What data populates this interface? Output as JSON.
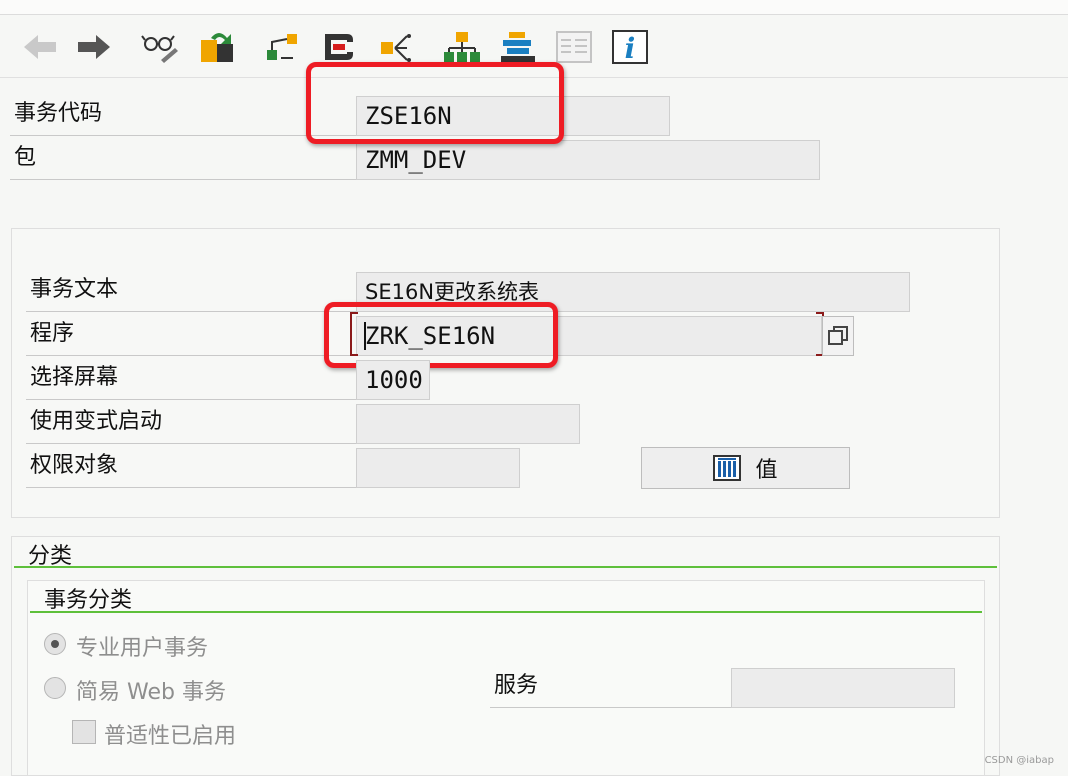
{
  "toolbar": {
    "icons": [
      "back-arrow-icon",
      "forward-arrow-icon",
      "display-glasses-icon",
      "change-object-icon",
      "hierarchy-transport-icon",
      "where-used-icon",
      "object-list-icon",
      "tree-org-icon",
      "stack-icon",
      "document-list-icon",
      "info-icon"
    ]
  },
  "header": {
    "transaction_code_label": "事务代码",
    "transaction_code_value": "ZSE16N",
    "package_label": "包",
    "package_value": "ZMM_DEV"
  },
  "details": {
    "text_label": "事务文本",
    "text_value": "SE16N更改系统表",
    "program_label": "程序",
    "program_value": "ZRK_SE16N",
    "screen_label": "选择屏幕",
    "screen_value": "1000",
    "variant_label": "使用变式启动",
    "variant_value": "",
    "auth_label": "权限对象",
    "auth_value": "",
    "values_button_label": "值"
  },
  "classification": {
    "title": "分类",
    "transaction_class_title": "事务分类",
    "option_professional": "专业用户事务",
    "option_easy_web": "简易 Web 事务",
    "service_label": "服务",
    "service_value": "",
    "pervasive_label": "普适性已启用"
  },
  "watermark": "CSDN @iabap",
  "colors": {
    "highlight": "#ee1c24",
    "section_line": "#5ec03b"
  }
}
